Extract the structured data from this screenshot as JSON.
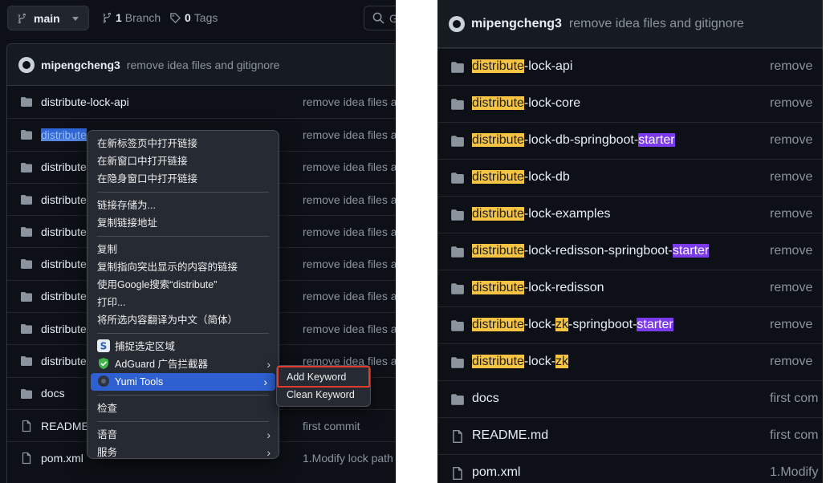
{
  "left": {
    "branch": {
      "label": "main"
    },
    "branches": {
      "count": "1",
      "label": "Branch"
    },
    "tags": {
      "count": "0",
      "label": "Tags"
    },
    "search_glyph": "G",
    "commit": {
      "author": "mipengcheng3",
      "message": "remove idea files and gitignore"
    },
    "rows": [
      {
        "name": "distribute-lock-api",
        "msg": "remove idea files a"
      },
      {
        "name": "distribute",
        "msg": "remove idea files a"
      },
      {
        "name": "distribute",
        "msg": "remove idea files a"
      },
      {
        "name": "distribute",
        "msg": "remove idea files a"
      },
      {
        "name": "distribute",
        "msg": "remove idea files a"
      },
      {
        "name": "distribute",
        "msg": "remove idea files a"
      },
      {
        "name": "distribute",
        "msg": "remove idea files a"
      },
      {
        "name": "distribute",
        "msg": "remove idea files a"
      },
      {
        "name": "distribute",
        "msg": "remove idea files a"
      },
      {
        "name": "docs",
        "msg": ""
      },
      {
        "name": "README",
        "msg": "first commit"
      },
      {
        "name": "pom.xml",
        "msg": "1.Modify lock path"
      }
    ]
  },
  "context_menu": {
    "items": [
      "在新标签页中打开链接",
      "在新窗口中打开链接",
      "在隐身窗口中打开链接",
      "链接存储为...",
      "复制链接地址",
      "复制",
      "复制指向突出显示的内容的链接",
      "使用Google搜索“distribute”",
      "打印...",
      "将所选内容翻译为中文（简体）",
      "捕捉选定区域",
      "AdGuard 广告拦截器",
      "Yumi Tools",
      "检查",
      "语音",
      "服务"
    ],
    "submenu": [
      "Add Keyword",
      "Clean Keyword"
    ]
  },
  "right": {
    "commit": {
      "author": "mipengcheng3",
      "message": "remove idea files and gitignore"
    },
    "rows": [
      {
        "p": [
          "distribute",
          "-lock-api"
        ],
        "msg": "remove"
      },
      {
        "p": [
          "distribute",
          "-lock-core"
        ],
        "msg": "remove"
      },
      {
        "p": [
          "distribute",
          "-lock-db-springboot-",
          "starter"
        ],
        "msg": "remove"
      },
      {
        "p": [
          "distribute",
          "-lock-db"
        ],
        "msg": "remove"
      },
      {
        "p": [
          "distribute",
          "-lock-examples"
        ],
        "msg": "remove"
      },
      {
        "p": [
          "distribute",
          "-lock-redisson-springboot-",
          "starter"
        ],
        "msg": "remove"
      },
      {
        "p": [
          "distribute",
          "-lock-redisson"
        ],
        "msg": "remove"
      },
      {
        "p": [
          "distribute",
          "-lock-",
          "zk",
          "-springboot-",
          "starter"
        ],
        "msg": "remove"
      },
      {
        "p": [
          "distribute",
          "-lock-",
          "zk"
        ],
        "msg": "remove"
      },
      {
        "p": [
          "docs"
        ],
        "msg": "first com"
      },
      {
        "p": [
          "README.md"
        ],
        "msg": "first com"
      },
      {
        "p": [
          "pom.xml"
        ],
        "msg": "1.Modify"
      }
    ]
  },
  "colors": {
    "background": "#0d1117",
    "highlight_yellow": "#f6c343",
    "highlight_purple": "#7c3aed",
    "menu_selection": "#2f60d1",
    "annotation_red": "#e23b2e"
  }
}
